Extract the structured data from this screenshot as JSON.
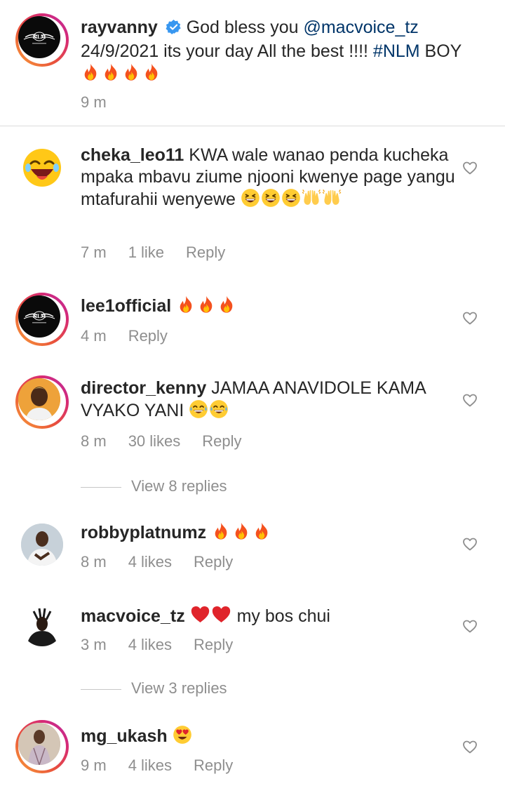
{
  "caption": {
    "username": "rayvanny",
    "text_a": " God bless you ",
    "mention": "@macvoice_tz",
    "text_b": " 24/9/2021 its your day All the best !!!! ",
    "hashtag": "#NLM",
    "text_c": " BOY",
    "time": "9 m",
    "verified_icon": "verified-badge-icon",
    "emoji": "fire-emoji"
  },
  "comments": [
    {
      "username": "cheka_leo11",
      "text": " KWA wale wanao penda kucheka mpaka mbavu ziume njooni kwenye page yangu mtafurahii wenyewe",
      "time": "7 m",
      "likes": "1 like",
      "reply": "Reply"
    },
    {
      "username": "lee1official",
      "text": "",
      "time": "4 m",
      "likes": "",
      "reply": "Reply"
    },
    {
      "username": "director_kenny",
      "text": " JAMAA ANAVIDOLE KAMA VYAKO YANI",
      "time": "8 m",
      "likes": "30 likes",
      "reply": "Reply",
      "view_replies": "View 8 replies"
    },
    {
      "username": "robbyplatnumz",
      "text": "",
      "time": "8 m",
      "likes": "4 likes",
      "reply": "Reply"
    },
    {
      "username": "macvoice_tz",
      "text": " my bos chui",
      "time": "3 m",
      "likes": "4 likes",
      "reply": "Reply",
      "view_replies": "View 3 replies"
    },
    {
      "username": "mg_ukash",
      "text": "",
      "time": "9 m",
      "likes": "4 likes",
      "reply": "Reply"
    }
  ],
  "avatar_logo_text": "NLM",
  "icons": {
    "like": "heart-outline-icon"
  },
  "colors": {
    "link": "#003569",
    "meta": "#8e8e8e",
    "text": "#262626",
    "verified": "#3897f0"
  }
}
